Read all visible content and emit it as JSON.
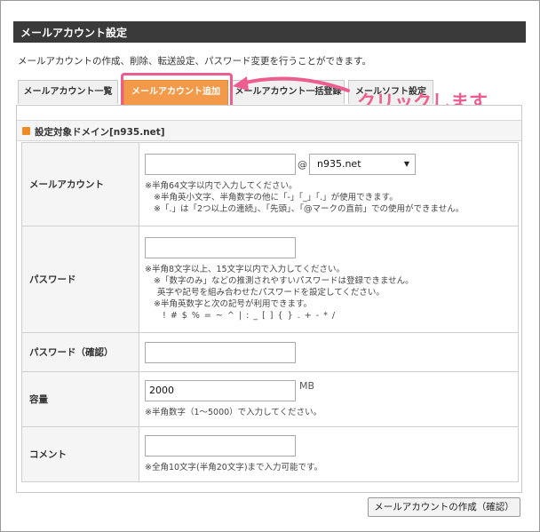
{
  "title": "メールアカウント設定",
  "description": "メールアカウントの作成、削除、転送設定、パスワード変更を行うことができます。",
  "tabs": [
    {
      "label": "メールアカウント一覧",
      "active": false
    },
    {
      "label": "メールアカウント追加",
      "active": true
    },
    {
      "label": "メールアカウント一括登録",
      "active": false
    },
    {
      "label": "メールソフト設定",
      "active": false
    }
  ],
  "annotation": {
    "text": "クリックします",
    "color": "#ee5d8f"
  },
  "section": {
    "title": "設定対象ドメイン[n935.net]"
  },
  "form": {
    "account": {
      "label": "メールアカウント",
      "value": "",
      "at": "@",
      "domain_selected": "n935.net",
      "notes": [
        "※半角64文字以内で入力してください。",
        "※半角英小文字、半角数字の他に「-」「_」「.」が使用できます。",
        "※「.」は「2つ以上の連続」、「先頭」、「@マークの直前」での使用ができません。"
      ]
    },
    "password": {
      "label": "パスワード",
      "value": "",
      "notes": [
        "※半角8文字以上、15文字以内で入力してください。",
        "※「数字のみ」などの推測されやすいパスワードは登録できません。",
        "英字や記号を組み合わせたパスワードを設定してください。",
        "※半角英数字と次の記号が利用できます。",
        "! # $ % = ~ ^ | : _ [ ] { } . + - * /"
      ]
    },
    "password_confirm": {
      "label": "パスワード（確認）",
      "value": ""
    },
    "capacity": {
      "label": "容量",
      "value": "2000",
      "unit": "MB",
      "note": "※半角数字（1～5000）で入力してください。"
    },
    "comment": {
      "label": "コメント",
      "value": "",
      "note": "※全角10文字(半角20文字)まで入力可能です。"
    }
  },
  "submit_label": "メールアカウントの作成（確認）",
  "colors": {
    "titlebar": "#3a3a3a",
    "active_tab": "#f29a4a",
    "accent": "#ee5d8f",
    "section_mark": "#f08a24"
  }
}
